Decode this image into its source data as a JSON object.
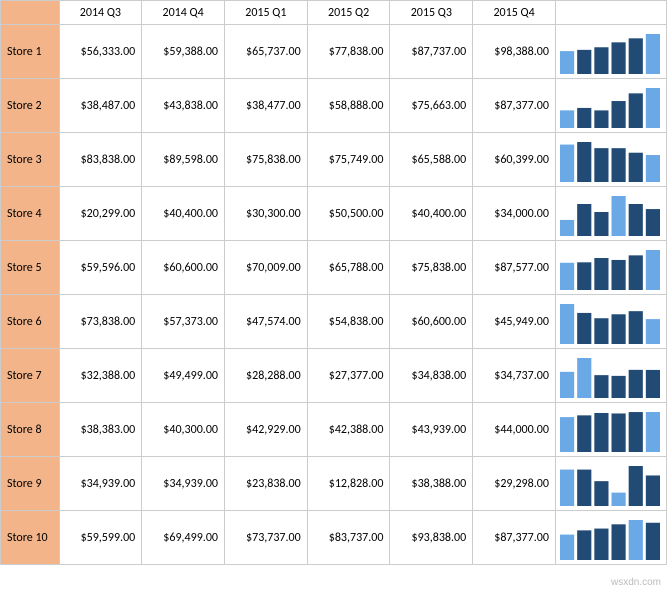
{
  "columns": [
    "2014 Q3",
    "2014 Q4",
    "2015 Q1",
    "2015 Q2",
    "2015 Q3",
    "2015 Q4"
  ],
  "rows": [
    {
      "label": "Store 1",
      "values": [
        56333.0,
        59388.0,
        65737.0,
        77838.0,
        87737.0,
        98388.0
      ]
    },
    {
      "label": "Store 2",
      "values": [
        38487.0,
        43838.0,
        38477.0,
        58888.0,
        75663.0,
        87377.0
      ]
    },
    {
      "label": "Store 3",
      "values": [
        83838.0,
        89598.0,
        75838.0,
        75749.0,
        65588.0,
        60399.0
      ]
    },
    {
      "label": "Store 4",
      "values": [
        20299.0,
        40400.0,
        30300.0,
        50500.0,
        40400.0,
        34000.0
      ]
    },
    {
      "label": "Store 5",
      "values": [
        59596.0,
        60600.0,
        70009.0,
        65788.0,
        75838.0,
        87577.0
      ]
    },
    {
      "label": "Store 6",
      "values": [
        73838.0,
        57373.0,
        47574.0,
        54838.0,
        60600.0,
        45949.0
      ]
    },
    {
      "label": "Store 7",
      "values": [
        32388.0,
        49499.0,
        28288.0,
        27377.0,
        34838.0,
        34737.0
      ]
    },
    {
      "label": "Store 8",
      "values": [
        38383.0,
        40300.0,
        42929.0,
        42388.0,
        43939.0,
        44000.0
      ]
    },
    {
      "label": "Store 9",
      "values": [
        34939.0,
        34939.0,
        23838.0,
        12828.0,
        38388.0,
        29298.0
      ]
    },
    {
      "label": "Store 10",
      "values": [
        59599.0,
        69499.0,
        73737.0,
        83737.0,
        93838.0,
        87377.0
      ]
    }
  ],
  "sparkline_colors": {
    "light": "#6aa8e6",
    "dark": "#214a75"
  },
  "watermark": "wsxdn.com",
  "chart_data": {
    "type": "bar",
    "title": "",
    "categories": [
      "2014 Q3",
      "2014 Q4",
      "2015 Q1",
      "2015 Q2",
      "2015 Q3",
      "2015 Q4"
    ],
    "series": [
      {
        "name": "Store 1",
        "values": [
          56333,
          59388,
          65737,
          77838,
          87737,
          98388
        ]
      },
      {
        "name": "Store 2",
        "values": [
          38487,
          43838,
          38477,
          58888,
          75663,
          87377
        ]
      },
      {
        "name": "Store 3",
        "values": [
          83838,
          89598,
          75838,
          75749,
          65588,
          60399
        ]
      },
      {
        "name": "Store 4",
        "values": [
          20299,
          40400,
          30300,
          50500,
          40400,
          34000
        ]
      },
      {
        "name": "Store 5",
        "values": [
          59596,
          60600,
          70009,
          65788,
          75838,
          87577
        ]
      },
      {
        "name": "Store 6",
        "values": [
          73838,
          57373,
          47574,
          54838,
          60600,
          45949
        ]
      },
      {
        "name": "Store 7",
        "values": [
          32388,
          49499,
          28288,
          27377,
          34838,
          34737
        ]
      },
      {
        "name": "Store 8",
        "values": [
          38383,
          40300,
          42929,
          42388,
          43939,
          44000
        ]
      },
      {
        "name": "Store 9",
        "values": [
          34939,
          34939,
          23838,
          12828,
          38388,
          29298
        ]
      },
      {
        "name": "Store 10",
        "values": [
          59599,
          69499,
          73737,
          83737,
          93838,
          87377
        ]
      }
    ],
    "xlabel": "",
    "ylabel": "",
    "legend": []
  }
}
